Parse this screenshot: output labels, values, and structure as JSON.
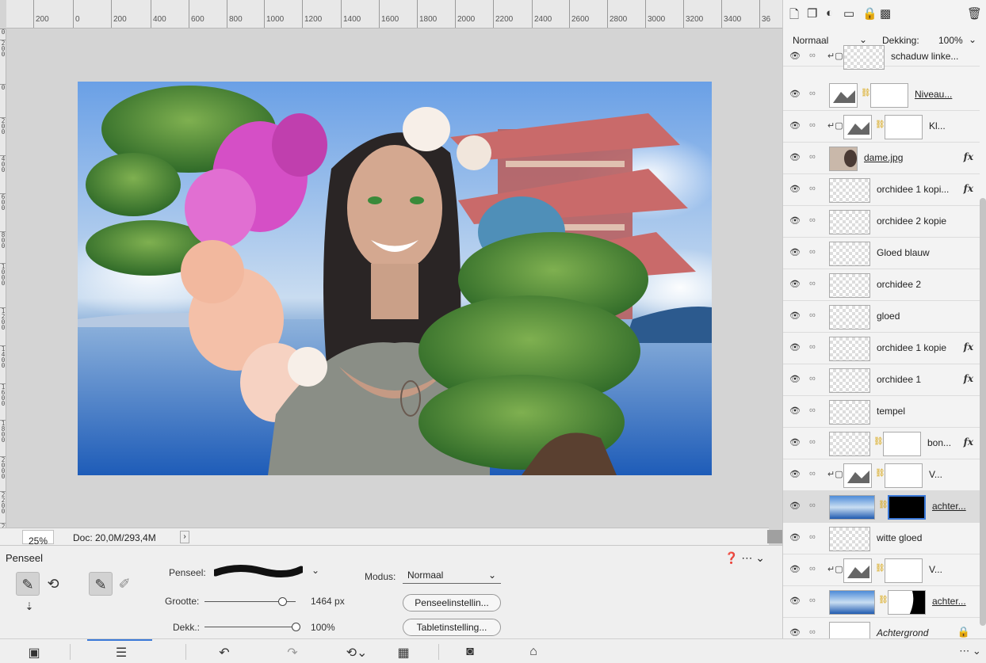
{
  "canvas": {
    "ruler_top_labels": [
      "200",
      "0",
      "200",
      "400",
      "600",
      "800",
      "1000",
      "1200",
      "1400",
      "1600",
      "1800",
      "2000",
      "2200",
      "2400",
      "2600",
      "2800",
      "3000",
      "3200",
      "3400",
      "36"
    ],
    "ruler_left_labels": [
      "0",
      "2\n0\n0",
      "0",
      "2\n0\n0",
      "4\n0\n0",
      "6\n0\n0",
      "8\n0\n0",
      "1\n0\n0\n0",
      "1\n2\n0\n0",
      "1\n4\n0\n0",
      "1\n6\n0\n0",
      "1\n8\n0\n0",
      "2\n0\n0\n0",
      "2\n2\n0\n0",
      "2"
    ]
  },
  "status": {
    "zoom": "25%",
    "doc": "Doc: 20,0M/293,4M",
    "arrow": "›"
  },
  "tool_options": {
    "title": "Penseel",
    "brush_label": "Penseel:",
    "mode_label": "Modus:",
    "mode_value": "Normaal",
    "size_label": "Grootte:",
    "size_value": "1464 px",
    "opacity_label": "Dekk.:",
    "opacity_value": "100%",
    "brush_settings_btn": "Penseelinstellin...",
    "tablet_settings_btn": "Tabletinstelling..."
  },
  "layers_panel": {
    "blend_mode": "Normaal",
    "opacity_label": "Dekking:",
    "opacity_value": "100%",
    "layers": [
      {
        "name": "schaduw linke...",
        "type": "pixel",
        "clip": true
      },
      {
        "name": "Niveau...",
        "type": "levels",
        "underline": true
      },
      {
        "name": "Kl...",
        "type": "curves",
        "clip": true
      },
      {
        "name": "dame.jpg",
        "type": "photo",
        "underline": true,
        "fx": true
      },
      {
        "name": "orchidee 1 kopi...",
        "type": "pixel",
        "fx": true
      },
      {
        "name": "orchidee 2 kopie",
        "type": "pixel"
      },
      {
        "name": "Gloed blauw",
        "type": "pixel"
      },
      {
        "name": "orchidee 2",
        "type": "pixel"
      },
      {
        "name": "gloed",
        "type": "pixel"
      },
      {
        "name": "orchidee 1 kopie",
        "type": "pixel",
        "fx": true
      },
      {
        "name": "orchidee 1",
        "type": "pixel",
        "fx": true
      },
      {
        "name": "tempel",
        "type": "pixel"
      },
      {
        "name": "bon...",
        "type": "pixel",
        "fx": true
      },
      {
        "name": "V...",
        "type": "adjust",
        "clip": true
      },
      {
        "name": "achter...",
        "type": "sky",
        "underline": true,
        "selected": true
      },
      {
        "name": "witte gloed",
        "type": "pixel"
      },
      {
        "name": "V...",
        "type": "adjust",
        "clip": true
      },
      {
        "name": "achter...",
        "type": "sky",
        "underline": true
      },
      {
        "name": "Achtergrond",
        "type": "background",
        "italic": true,
        "locked": true
      }
    ]
  },
  "colors": {
    "accent": "#3b79d8",
    "selected_row": "#dcdcdc"
  }
}
